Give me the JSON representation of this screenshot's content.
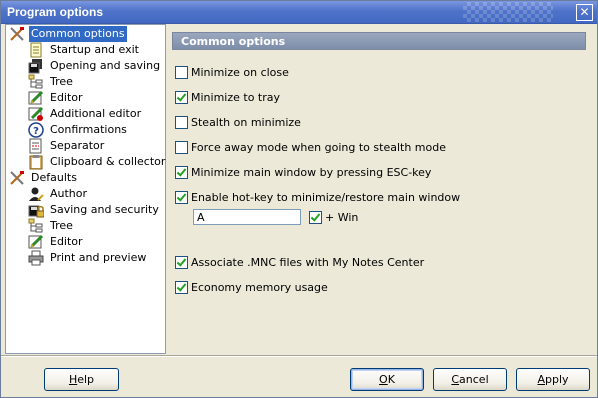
{
  "window": {
    "title": "Program options",
    "close_label": "✕"
  },
  "tree": {
    "items": [
      {
        "label": "Common options",
        "icon": "tools-icon",
        "selected": true
      },
      {
        "label": "Startup and exit",
        "icon": "page-icon"
      },
      {
        "label": "Opening and saving",
        "icon": "disks-icon"
      },
      {
        "label": "Tree",
        "icon": "tree-icon"
      },
      {
        "label": "Editor",
        "icon": "editor-icon"
      },
      {
        "label": "Additional editor",
        "icon": "additional-editor-icon"
      },
      {
        "label": "Confirmations",
        "icon": "question-icon"
      },
      {
        "label": "Separator",
        "icon": "separator-icon"
      },
      {
        "label": "Clipboard & collector",
        "icon": "clipboard-icon"
      },
      {
        "label": "Defaults",
        "icon": "tools-icon"
      },
      {
        "label": "Author",
        "icon": "author-icon"
      },
      {
        "label": "Saving and security",
        "icon": "security-icon"
      },
      {
        "label": "Tree",
        "icon": "tree-icon"
      },
      {
        "label": "Editor",
        "icon": "editor-icon"
      },
      {
        "label": "Print and preview",
        "icon": "printer-icon"
      }
    ]
  },
  "section": {
    "title": "Common options"
  },
  "options": [
    {
      "label": "Minimize on close",
      "checked": false
    },
    {
      "label": "Minimize to tray",
      "checked": true
    },
    {
      "label": "Stealth on minimize",
      "checked": false
    },
    {
      "label": "Force away mode when going to stealth mode",
      "checked": false
    },
    {
      "label": "Minimize main window by pressing ESC-key",
      "checked": true
    },
    {
      "label": "Enable hot-key to minimize/restore main window",
      "checked": true
    },
    {
      "label": "Associate .MNC files with My Notes Center",
      "checked": true
    },
    {
      "label": "Economy memory usage",
      "checked": true
    }
  ],
  "hotkey": {
    "value": "A",
    "win_label": "+ Win",
    "win_checked": true
  },
  "buttons": {
    "help": {
      "pre": "",
      "u": "H",
      "post": "elp"
    },
    "ok": {
      "pre": "",
      "u": "O",
      "post": "K"
    },
    "cancel": {
      "pre": "",
      "u": "C",
      "post": "ancel"
    },
    "apply": {
      "pre": "",
      "u": "A",
      "post": "pply"
    }
  },
  "colors": {
    "selection": "#316ac5",
    "titlebar": "#4f73c9",
    "section_header": "#7e8ea9"
  }
}
